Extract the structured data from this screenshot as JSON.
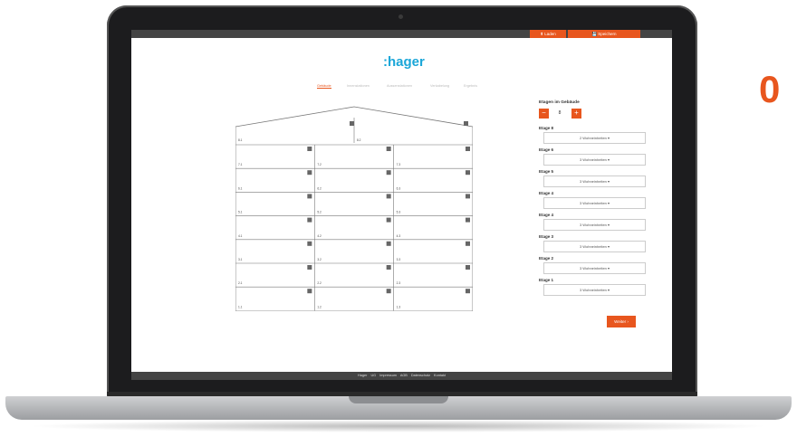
{
  "overlay": {
    "big_digit": "0"
  },
  "header": {
    "load_label": "⬆ Laden",
    "save_label": "💾 Speichern"
  },
  "brand": {
    "logo": ":hager",
    "accent": "#e8561e",
    "logo_color": "#1aa6d8"
  },
  "tabs": [
    "Gebäude",
    "Innenstationen",
    "Aussenstationen",
    "Verkabelung",
    "Ergebnis"
  ],
  "building": {
    "roof_units": [
      "8.1",
      "8.2"
    ],
    "rows": [
      [
        "7.1",
        "7.2",
        "7.3"
      ],
      [
        "6.1",
        "6.2",
        "6.3"
      ],
      [
        "5.1",
        "5.2",
        "5.3"
      ],
      [
        "4.1",
        "4.2",
        "4.3"
      ],
      [
        "3.1",
        "3.2",
        "3.3"
      ],
      [
        "2.1",
        "2.2",
        "2.3"
      ],
      [
        "1.1",
        "1.2",
        "1.3"
      ]
    ]
  },
  "panel": {
    "title": "Etagen im Gebäude",
    "minus": "−",
    "plus": "+",
    "count": "8",
    "floors": [
      {
        "label": "Etage 8",
        "value": "2 Wohneinheiten ▾"
      },
      {
        "label": "Etage 6",
        "value": "3 Wohneinheiten ▾"
      },
      {
        "label": "Etage 5",
        "value": "3 Wohneinheiten ▾"
      },
      {
        "label": "Etage 4",
        "value": "3 Wohneinheiten ▾"
      },
      {
        "label": "Etage 4",
        "value": "3 Wohneinheiten ▾"
      },
      {
        "label": "Etage 3",
        "value": "3 Wohneinheiten ▾"
      },
      {
        "label": "Etage 2",
        "value": "3 Wohneinheiten ▾"
      },
      {
        "label": "Etage 1",
        "value": "3 Wohneinheiten ▾"
      }
    ],
    "next_label": "Weiter ›"
  },
  "footer": {
    "text": "Hager UG Impressum AGB Datenschutz Kontakt"
  }
}
